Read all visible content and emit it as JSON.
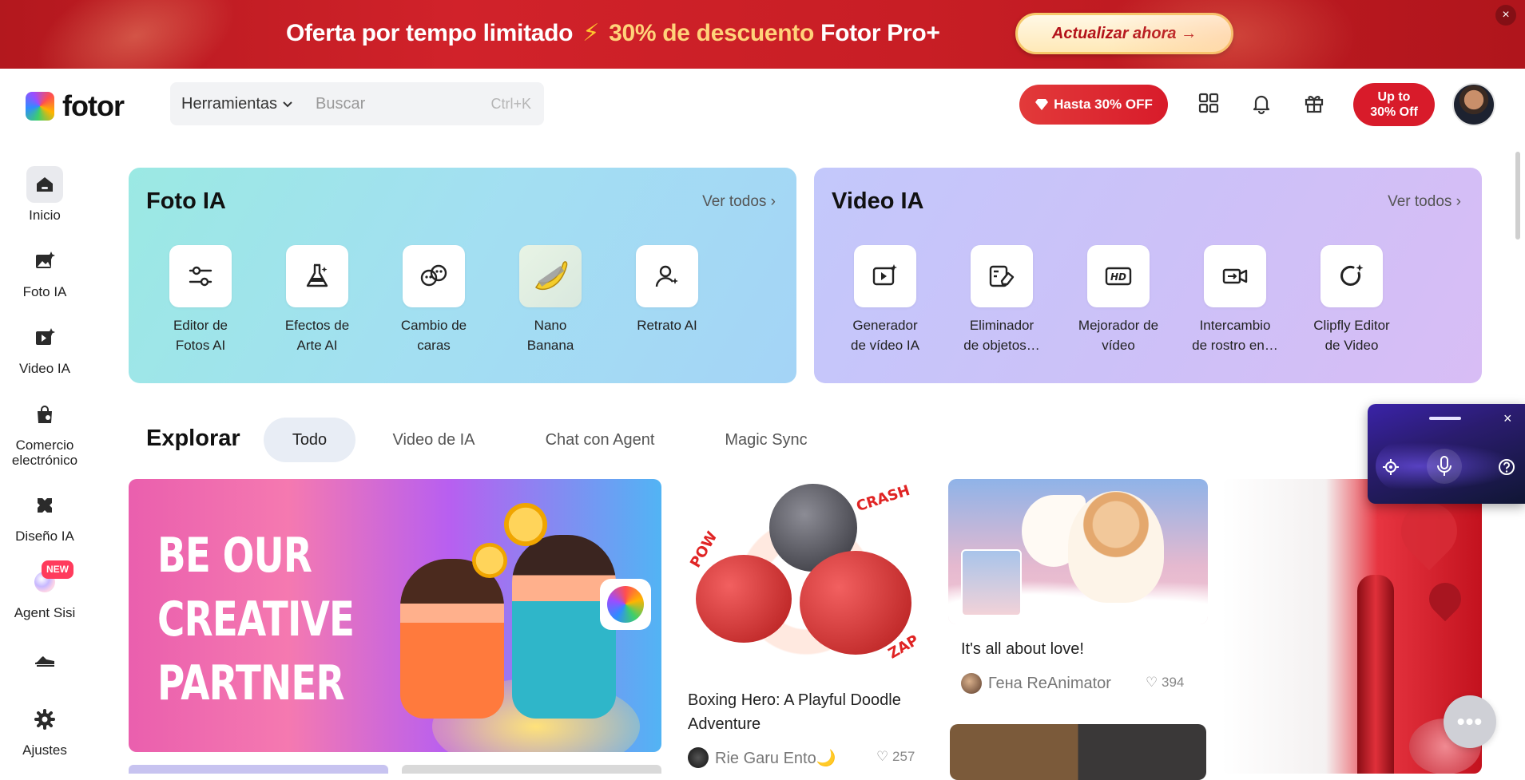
{
  "promo": {
    "text_part1": "Oferta por tempo limitado",
    "bolt": "⚡",
    "text_discount": "30% de descuento",
    "text_part2": "Fotor Pro+",
    "cta": "Actualizar ahora →",
    "close": "×"
  },
  "header": {
    "logo_text": "fotor",
    "tools_label": "Herramientas",
    "search_placeholder": "Buscar",
    "search_shortcut": "Ctrl+K",
    "sale_button": "Hasta 30% OFF",
    "upto_button_line1": "Up to",
    "upto_button_line2": "30% Off"
  },
  "sidebar": {
    "items": [
      {
        "label": "Inicio",
        "icon": "home-icon"
      },
      {
        "label": "Foto IA",
        "icon": "image-sparkle-icon"
      },
      {
        "label": "Video IA",
        "icon": "video-sparkle-icon"
      },
      {
        "label": "Comercio electrónico",
        "icon": "shopping-bag-icon"
      },
      {
        "label": "Diseño IA",
        "icon": "design-tools-icon"
      },
      {
        "label": "Agent Sisi",
        "icon": "agent-orb-icon",
        "badge": "NEW"
      },
      {
        "label": "",
        "icon": "sneaker-icon"
      },
      {
        "label": "Ajustes",
        "icon": "gear-icon"
      }
    ]
  },
  "foto_ia": {
    "title": "Foto IA",
    "see_all": "Ver todos ›",
    "tools": [
      {
        "line1": "Editor de",
        "line2": "Fotos AI",
        "icon": "sliders-icon"
      },
      {
        "line1": "Efectos de",
        "line2": "Arte AI",
        "icon": "flask-icon"
      },
      {
        "line1": "Cambio de",
        "line2": "caras",
        "icon": "face-swap-icon"
      },
      {
        "line1": "Nano",
        "line2": "Banana",
        "icon": "banana-icon"
      },
      {
        "line1": "Retrato AI",
        "line2": "",
        "icon": "portrait-icon"
      }
    ]
  },
  "video_ia": {
    "title": "Video IA",
    "see_all": "Ver todos ›",
    "tools": [
      {
        "line1": "Generador",
        "line2": "de vídeo IA",
        "icon": "video-generate-icon"
      },
      {
        "line1": "Eliminador",
        "line2": "de objetos…",
        "icon": "eraser-icon"
      },
      {
        "line1": "Mejorador de",
        "line2": "vídeo",
        "icon": "hd-icon"
      },
      {
        "line1": "Intercambio",
        "line2": "de rostro en…",
        "icon": "video-swap-icon"
      },
      {
        "line1": "Clipfly Editor",
        "line2": "de Video",
        "icon": "clipfly-icon"
      }
    ]
  },
  "explore": {
    "title": "Explorar",
    "tabs": [
      "Todo",
      "Video de IA",
      "Chat con Agent",
      "Magic Sync"
    ]
  },
  "gallery": {
    "banner_text": [
      "BE OUR",
      "CREATIVE",
      "PARTNER"
    ],
    "items": [
      {
        "title_line1": "Boxing Hero: A Playful Doodle",
        "title_line2": "Adventure",
        "user": "Rie Garu Ento🌙",
        "likes": "257"
      },
      {
        "title_line1": "It's all about love!",
        "title_line2": "",
        "user": "Гена ReAnimator",
        "likes": "394"
      }
    ],
    "comic_words": [
      "CRASH",
      "POW",
      "ZAP"
    ]
  },
  "voice_widget": {
    "close": "×"
  },
  "more_button": "•••",
  "colors": {
    "promo_red": "#c81e25",
    "sale_red": "#d81b2a",
    "foto_card": "#a3dff2",
    "video_card": "#ccc1f8",
    "tab_active_bg": "#e8edf5"
  }
}
